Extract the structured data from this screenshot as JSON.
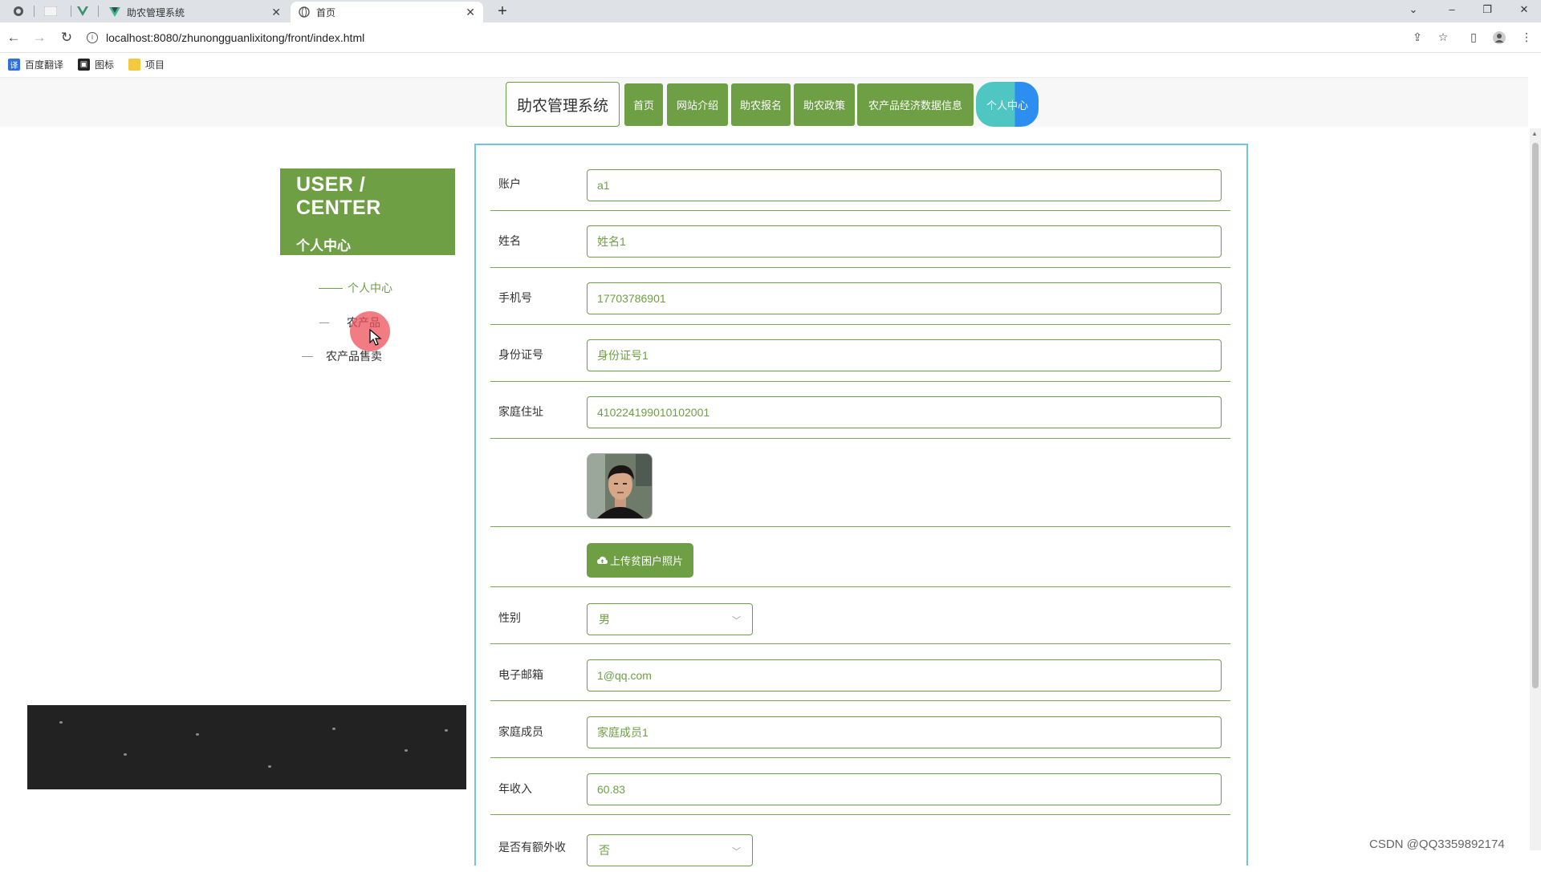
{
  "browser": {
    "tabs": [
      {
        "title": "助农管理系统",
        "icon": "vue-icon"
      },
      {
        "title": "首页",
        "icon": "globe-icon"
      }
    ],
    "url": "localhost:8080/zhunongguanlixitong/front/index.html",
    "bookmarks": [
      {
        "label": "百度翻译",
        "icon": "translate-icon",
        "color": "#2f6fe0"
      },
      {
        "label": "图标",
        "icon": "image-icon",
        "color": "#222222"
      },
      {
        "label": "项目",
        "icon": "folder-icon",
        "color": "#f3c940"
      }
    ]
  },
  "header": {
    "logo": "助农管理系统",
    "nav": [
      "首页",
      "网站介绍",
      "助农报名",
      "助农政策",
      "农产品经济数据信息"
    ],
    "user_center": "个人中心",
    "accent": "#6e9f45"
  },
  "sidebar": {
    "title_en": "USER / CENTER",
    "title_cn": "个人中心",
    "links": [
      "个人中心",
      "农产品",
      "农产品售卖"
    ]
  },
  "form": {
    "fields": [
      {
        "label": "账户",
        "value": "a1"
      },
      {
        "label": "姓名",
        "value": "姓名1"
      },
      {
        "label": "手机号",
        "value": "17703786901"
      },
      {
        "label": "身份证号",
        "value": "身份证号1"
      },
      {
        "label": "家庭住址",
        "value": "410224199010102001"
      }
    ],
    "upload_label": "上传贫困户照片",
    "gender": {
      "label": "性别",
      "value": "男"
    },
    "fields2": [
      {
        "label": "电子邮箱",
        "value": "1@qq.com"
      },
      {
        "label": "家庭成员",
        "value": "家庭成员1"
      },
      {
        "label": "年收入",
        "value": "60.83"
      }
    ],
    "extra_income": {
      "label": "是否有额外收",
      "value": "否"
    }
  },
  "watermark": "CSDN @QQ3359892174"
}
